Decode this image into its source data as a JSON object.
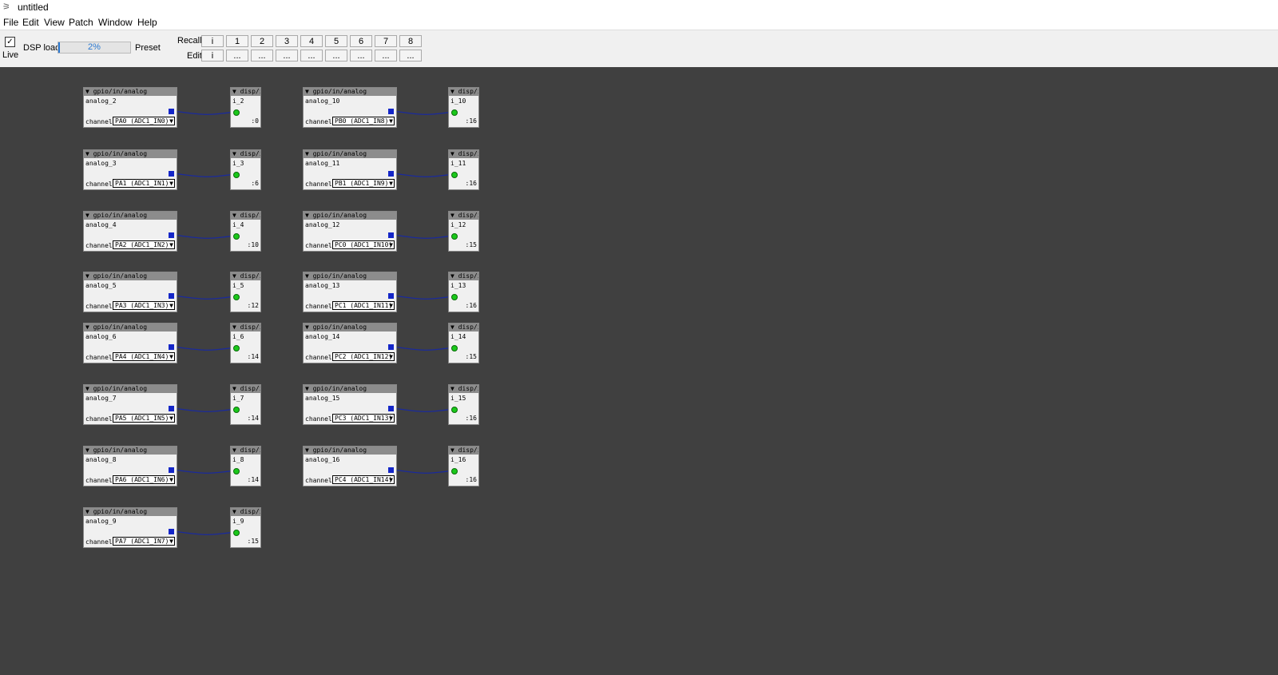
{
  "window": {
    "title": "untitled"
  },
  "menu": [
    "File",
    "Edit",
    "View",
    "Patch",
    "Window",
    "Help"
  ],
  "toolbar": {
    "live_label": "Live",
    "live_checked": true,
    "dsp_label": "DSP load",
    "dsp_value": "2%",
    "dsp_fraction": 0.02,
    "preset_label": "Preset",
    "recall_label": "Recall",
    "edit_label": "Edit",
    "recall_buttons": [
      "i",
      "1",
      "2",
      "3",
      "4",
      "5",
      "6",
      "7",
      "8"
    ],
    "edit_buttons": [
      "i",
      "...",
      "...",
      "...",
      "...",
      "...",
      "...",
      "...",
      "..."
    ]
  },
  "patch": {
    "analog_header": "▼ gpio/in/analog",
    "disp_header": "▼ disp/i",
    "channel_label": "channel",
    "pairs": [
      {
        "analog_name": "analog_2",
        "channel": "PA0 (ADC1_IN0)",
        "disp_name": "i_2",
        "value": ":0"
      },
      {
        "analog_name": "analog_3",
        "channel": "PA1 (ADC1_IN1)",
        "disp_name": "i_3",
        "value": ":6"
      },
      {
        "analog_name": "analog_4",
        "channel": "PA2 (ADC1_IN2)",
        "disp_name": "i_4",
        "value": ":10"
      },
      {
        "analog_name": "analog_5",
        "channel": "PA3 (ADC1_IN3)",
        "disp_name": "i_5",
        "value": ":12"
      },
      {
        "analog_name": "analog_6",
        "channel": "PA4 (ADC1_IN4)",
        "disp_name": "i_6",
        "value": ":14"
      },
      {
        "analog_name": "analog_7",
        "channel": "PA5 (ADC1_IN5)",
        "disp_name": "i_7",
        "value": ":14"
      },
      {
        "analog_name": "analog_8",
        "channel": "PA6 (ADC1_IN6)",
        "disp_name": "i_8",
        "value": ":14"
      },
      {
        "analog_name": "analog_9",
        "channel": "PA7 (ADC1_IN7)",
        "disp_name": "i_9",
        "value": ":15"
      },
      {
        "analog_name": "analog_10",
        "channel": "PB0 (ADC1_IN8)",
        "disp_name": "i_10",
        "value": ":16"
      },
      {
        "analog_name": "analog_11",
        "channel": "PB1 (ADC1_IN9)",
        "disp_name": "i_11",
        "value": ":16"
      },
      {
        "analog_name": "analog_12",
        "channel": "PC0 (ADC1_IN10)",
        "disp_name": "i_12",
        "value": ":15"
      },
      {
        "analog_name": "analog_13",
        "channel": "PC1 (ADC1_IN11)",
        "disp_name": "i_13",
        "value": ":16"
      },
      {
        "analog_name": "analog_14",
        "channel": "PC2 (ADC1_IN12)",
        "disp_name": "i_14",
        "value": ":15"
      },
      {
        "analog_name": "analog_15",
        "channel": "PC3 (ADC1_IN13)",
        "disp_name": "i_15",
        "value": ":16"
      },
      {
        "analog_name": "analog_16",
        "channel": "PC4 (ADC1_IN14)",
        "disp_name": "i_16",
        "value": ":16"
      }
    ]
  },
  "colors": {
    "canvas": "#404040",
    "object_header": "#8c8c8c",
    "outlet": "#1426c8",
    "inlet": "#1ac81a",
    "wire": "#1a2a9c",
    "dsp_bar": "#2a78d0"
  }
}
